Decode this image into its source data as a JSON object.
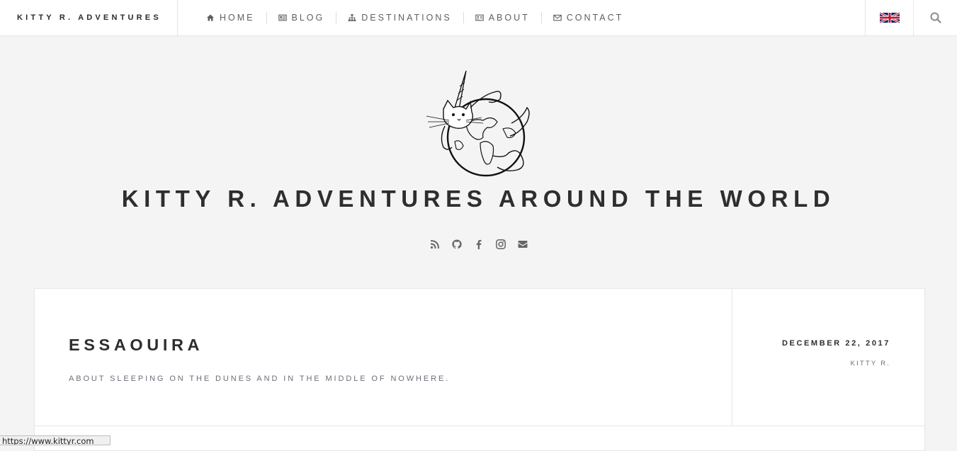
{
  "header": {
    "brand": "KITTY R. ADVENTURES",
    "nav": [
      {
        "label": "HOME",
        "icon": "home-icon"
      },
      {
        "label": "BLOG",
        "icon": "newspaper-icon"
      },
      {
        "label": "DESTINATIONS",
        "icon": "sitemap-icon"
      },
      {
        "label": "ABOUT",
        "icon": "id-card-icon"
      },
      {
        "label": "CONTACT",
        "icon": "envelope-icon"
      }
    ],
    "language_icon": "uk-flag-icon",
    "search_icon": "search-icon"
  },
  "hero": {
    "logo_icon": "unicorn-cat-globe-logo",
    "title": "KITTY R. ADVENTURES AROUND THE WORLD",
    "social_icons": [
      "rss-icon",
      "github-icon",
      "facebook-icon",
      "instagram-icon",
      "envelope-icon"
    ]
  },
  "post": {
    "title": "ESSAOUIRA",
    "subtitle": "ABOUT SLEEPING ON THE DUNES AND IN THE MIDDLE OF NOWHERE.",
    "date": "DECEMBER 22, 2017",
    "author": "KITTY R."
  },
  "statusbar": {
    "url": "https://www.kittyr.com"
  },
  "colors": {
    "page_bg": "#f4f4f4",
    "card_bg": "#ffffff",
    "text_dark": "#2f2e2e",
    "text_muted": "#6c6c7a",
    "border": "#e6e6e6"
  }
}
